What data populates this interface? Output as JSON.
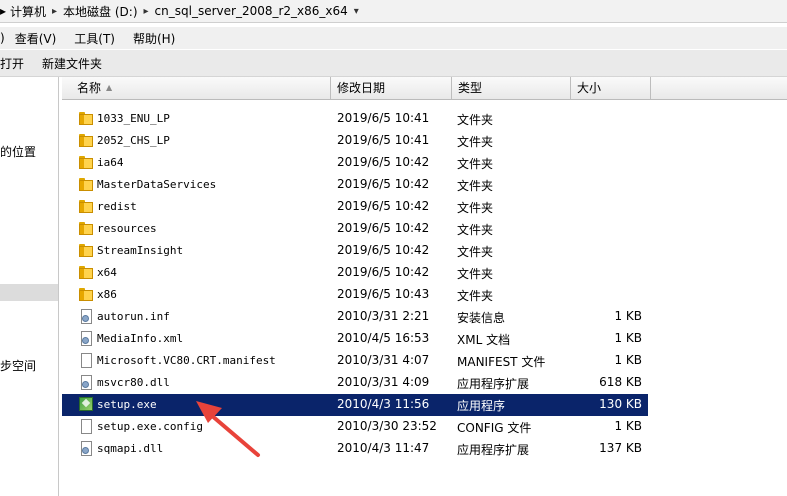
{
  "address": {
    "segments": [
      "计算机",
      "本地磁盘 (D:)",
      "cn_sql_server_2008_r2_x86_x64"
    ]
  },
  "menu": {
    "items": [
      "编辑(E)",
      "查看(V)",
      "工具(T)",
      "帮助(H)"
    ],
    "visible": [
      ")",
      "查看(V)",
      "工具(T)",
      "帮助(H)"
    ]
  },
  "toolbar": {
    "open_label": "打开",
    "new_folder_label": "新建文件夹"
  },
  "nav": {
    "recent_places": "的位置",
    "sync_center": "步空间"
  },
  "columns": {
    "name": "名称",
    "date": "修改日期",
    "type": "类型",
    "size": "大小"
  },
  "files": [
    {
      "name": "1033_ENU_LP",
      "date": "2019/6/5 10:41",
      "type": "文件夹",
      "size": "",
      "kind": "folder"
    },
    {
      "name": "2052_CHS_LP",
      "date": "2019/6/5 10:41",
      "type": "文件夹",
      "size": "",
      "kind": "folder"
    },
    {
      "name": "ia64",
      "date": "2019/6/5 10:42",
      "type": "文件夹",
      "size": "",
      "kind": "folder"
    },
    {
      "name": "MasterDataServices",
      "date": "2019/6/5 10:42",
      "type": "文件夹",
      "size": "",
      "kind": "folder"
    },
    {
      "name": "redist",
      "date": "2019/6/5 10:42",
      "type": "文件夹",
      "size": "",
      "kind": "folder"
    },
    {
      "name": "resources",
      "date": "2019/6/5 10:42",
      "type": "文件夹",
      "size": "",
      "kind": "folder"
    },
    {
      "name": "StreamInsight",
      "date": "2019/6/5 10:42",
      "type": "文件夹",
      "size": "",
      "kind": "folder"
    },
    {
      "name": "x64",
      "date": "2019/6/5 10:42",
      "type": "文件夹",
      "size": "",
      "kind": "folder"
    },
    {
      "name": "x86",
      "date": "2019/6/5 10:43",
      "type": "文件夹",
      "size": "",
      "kind": "folder"
    },
    {
      "name": "autorun.inf",
      "date": "2010/3/31 2:21",
      "type": "安装信息",
      "size": "1 KB",
      "kind": "file"
    },
    {
      "name": "MediaInfo.xml",
      "date": "2010/4/5 16:53",
      "type": "XML 文档",
      "size": "1 KB",
      "kind": "file"
    },
    {
      "name": "Microsoft.VC80.CRT.manifest",
      "date": "2010/3/31 4:07",
      "type": "MANIFEST 文件",
      "size": "1 KB",
      "kind": "file"
    },
    {
      "name": "msvcr80.dll",
      "date": "2010/3/31 4:09",
      "type": "应用程序扩展",
      "size": "618 KB",
      "kind": "file"
    },
    {
      "name": "setup.exe",
      "date": "2010/4/3 11:56",
      "type": "应用程序",
      "size": "130 KB",
      "kind": "exe",
      "selected": true
    },
    {
      "name": "setup.exe.config",
      "date": "2010/3/30 23:52",
      "type": "CONFIG 文件",
      "size": "1 KB",
      "kind": "file"
    },
    {
      "name": "sqmapi.dll",
      "date": "2010/4/3 11:47",
      "type": "应用程序扩展",
      "size": "137 KB",
      "kind": "file"
    }
  ],
  "colors": {
    "selection": "#0a246a",
    "annotation_arrow": "#e8433a",
    "folder": "#ffd34d"
  }
}
